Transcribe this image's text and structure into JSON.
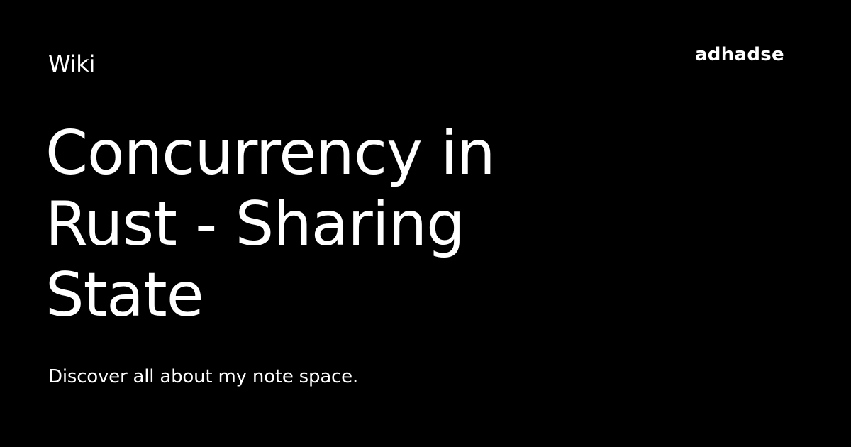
{
  "header": {
    "section_label": "Wiki",
    "brand_name": "adhadse"
  },
  "main": {
    "title": "Concurrency in Rust - Sharing State",
    "subtitle": "Discover all about my note space."
  },
  "colors": {
    "background": "#000000",
    "text": "#ffffff"
  }
}
